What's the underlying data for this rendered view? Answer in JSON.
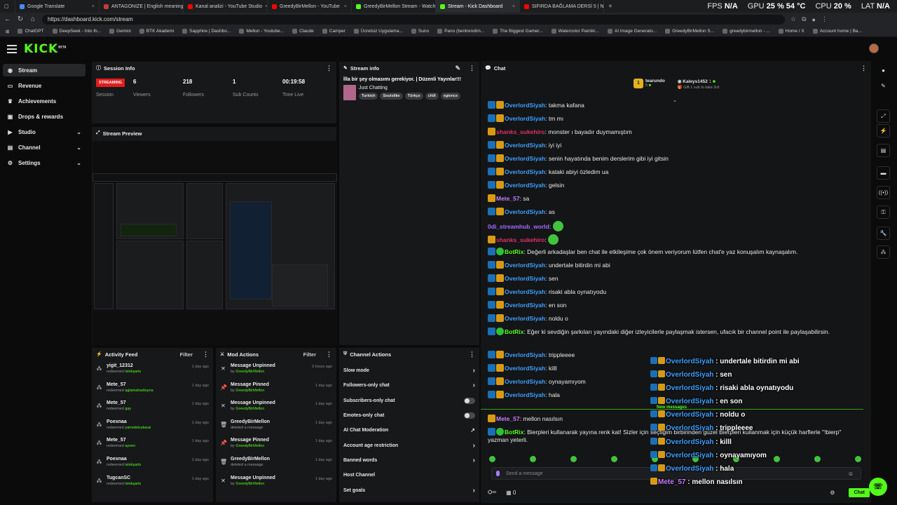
{
  "tabs": [
    {
      "label": "Google Translate",
      "color": "#4a8af4",
      "active": false
    },
    {
      "label": "ANTAGONIZE | English meaning - ...",
      "color": "#c53b3b",
      "active": false
    },
    {
      "label": "Kanal analizi - YouTube Studio",
      "color": "#ff0000",
      "active": false
    },
    {
      "label": "GreedyBirMellon - YouTube",
      "color": "#ff0000",
      "active": false
    },
    {
      "label": "GreedyBirMellon Stream - Watch Li...",
      "color": "#53fc18",
      "active": false
    },
    {
      "label": "Stream - Kick Dashboard",
      "color": "#53fc18",
      "active": true
    },
    {
      "label": "SIFIRDA BAĞLAMA DERSİ 5 | Nota...",
      "color": "#ff0000",
      "active": false
    }
  ],
  "sys": {
    "fps_label": "FPS",
    "fps": "N/A",
    "gpu_label": "GPU",
    "gpu": "25 %  54 °C",
    "cpu_label": "CPU",
    "cpu": "20 %",
    "lat_label": "LAT",
    "lat": "N/A"
  },
  "url": "https://dashboard.kick.com/stream",
  "bookmarks": [
    "ChatGPT",
    "DeepSeek - Into th...",
    "Gemini",
    "BTK Akademi",
    "Sapphire | Dashbo...",
    "Mellon - Youtube...",
    "Claude",
    "Camper",
    "Ücretsiz Uygulama...",
    "Suno",
    "Pano (bentrendim...",
    "The Biggest Gamer...",
    "Watercolor Paintin...",
    "AI Image Generato...",
    "GreedyBirMellon S...",
    "greedybirmellon - ...",
    "Home / X",
    "Account home | Ba..."
  ],
  "logo": "KICK",
  "logo_sup": "BETA",
  "sidebar": [
    {
      "label": "Stream",
      "icon": "broadcast-icon",
      "active": true,
      "chev": false
    },
    {
      "label": "Revenue",
      "icon": "wallet-icon",
      "active": false,
      "chev": false
    },
    {
      "label": "Achievements",
      "icon": "trophy-icon",
      "active": false,
      "chev": false
    },
    {
      "label": "Drops & rewards",
      "icon": "gift-icon",
      "active": false,
      "chev": false
    },
    {
      "label": "Studio",
      "icon": "studio-icon",
      "active": false,
      "chev": true
    },
    {
      "label": "Channel",
      "icon": "channel-icon",
      "active": false,
      "chev": true
    },
    {
      "label": "Settings",
      "icon": "gear-icon",
      "active": false,
      "chev": true
    }
  ],
  "session": {
    "title": "Session Info",
    "badge": "STREAMING",
    "session_label": "Session",
    "stats": [
      {
        "value": "6",
        "label": "Viewers"
      },
      {
        "value": "218",
        "label": "Followers"
      },
      {
        "value": "1",
        "label": "Sub Counts"
      },
      {
        "value": "00:19:58",
        "label": "Time Live"
      }
    ]
  },
  "preview": {
    "title": "Stream Preview"
  },
  "stream_info": {
    "header": "Stream info",
    "title": "İlla bir şey olmasımı gerekiyor. | Düzenli Yayınlar!!!",
    "category": "Just Chatting",
    "tags": [
      "Turkish",
      "Soulslike",
      "Türkçe",
      "chill",
      "eglence"
    ]
  },
  "activity": {
    "title": "Activity Feed",
    "filter": "Filter",
    "items": [
      {
        "name": "yigit_12312",
        "text": "redeemed",
        "reward": "istekşarkı",
        "time": "1 day ago"
      },
      {
        "name": "Mete_57",
        "text": "redeemed",
        "reward": "aglamahadioyna",
        "time": "1 day ago"
      },
      {
        "name": "Mete_57",
        "text": "redeemed",
        "reward": "gay",
        "time": "1 day ago"
      },
      {
        "name": "Poexnaa",
        "text": "redeemed",
        "reward": "yametekudasai",
        "time": "1 day ago"
      },
      {
        "name": "Mete_57",
        "text": "redeemed",
        "reward": "aynen",
        "time": "1 day ago"
      },
      {
        "name": "Poexnaa",
        "text": "redeemed",
        "reward": "istekşarkı",
        "time": "1 day ago"
      },
      {
        "name": "TugcanSC",
        "text": "redeemed",
        "reward": "istekşarkı",
        "time": "1 day ago"
      }
    ]
  },
  "mod": {
    "title": "Mod Actions",
    "filter": "Filter",
    "items": [
      {
        "action": "Message Unpinned",
        "sub": "by",
        "who": "GreedyBirMellon",
        "time": "3 hours ago",
        "icon": "unpin-icon"
      },
      {
        "action": "Message Pinned",
        "sub": "by",
        "who": "GreedyBirMellon",
        "time": "1 day ago",
        "icon": "pin-icon"
      },
      {
        "action": "Message Unpinned",
        "sub": "by",
        "who": "GreedyBirMellon",
        "time": "1 day ago",
        "icon": "unpin-icon"
      },
      {
        "action": "GreedyBirMellon",
        "sub": "deleted a message",
        "who": "",
        "time": "1 day ago",
        "icon": "trash-icon"
      },
      {
        "action": "Message Pinned",
        "sub": "by",
        "who": "GreedyBirMellon",
        "time": "1 day ago",
        "icon": "pin-icon"
      },
      {
        "action": "GreedyBirMellon",
        "sub": "deleted a message",
        "who": "",
        "time": "1 day ago",
        "icon": "trash-icon"
      },
      {
        "action": "Message Unpinned",
        "sub": "by",
        "who": "GreedyBirMellon",
        "time": "1 day ago",
        "icon": "unpin-icon"
      }
    ]
  },
  "channel_actions": {
    "title": "Channel Actions",
    "items": [
      {
        "label": "Slow mode",
        "ctrl": "arrow"
      },
      {
        "label": "Followers-only chat",
        "ctrl": "arrow"
      },
      {
        "label": "Subscribers-only chat",
        "ctrl": "toggle"
      },
      {
        "label": "Emotes-only chat",
        "ctrl": "toggle"
      },
      {
        "label": "AI Chat Moderation",
        "ctrl": "ext"
      },
      {
        "label": "Account age restriction",
        "ctrl": "arrow"
      },
      {
        "label": "Banned words",
        "ctrl": "arrow"
      },
      {
        "label": "Host Channel",
        "ctrl": "none"
      },
      {
        "label": "Set goals",
        "ctrl": "arrow"
      }
    ]
  },
  "chat": {
    "title": "Chat",
    "top1": {
      "user": "tearundo",
      "count": "5",
      "rank": "1"
    },
    "top2": {
      "user": "Kaleys1452",
      "count": "1",
      "gift": "Gift 1 sub to take 3rd"
    },
    "messages": [
      {
        "user": "OverlordSiyah",
        "color": "#3ea0ff",
        "badges": [
          "mod",
          "vip"
        ],
        "text": "takma kafana"
      },
      {
        "user": "OverlordSiyah",
        "color": "#3ea0ff",
        "badges": [
          "mod",
          "vip"
        ],
        "text": "tm mı"
      },
      {
        "user": "shanks_sukehiro",
        "color": "#e0306a",
        "badges": [
          "vip"
        ],
        "text": "monster ı bayadır duymamıştım"
      },
      {
        "user": "OverlordSiyah",
        "color": "#3ea0ff",
        "badges": [
          "mod",
          "vip"
        ],
        "text": "iyi iyi"
      },
      {
        "user": "OverlordSiyah",
        "color": "#3ea0ff",
        "badges": [
          "mod",
          "vip"
        ],
        "text": "senin hayatında benim derslerim gibi iyi gitsin"
      },
      {
        "user": "OverlordSiyah",
        "color": "#3ea0ff",
        "badges": [
          "mod",
          "vip"
        ],
        "text": "kataki abiyi özledim ua"
      },
      {
        "user": "OverlordSiyah",
        "color": "#3ea0ff",
        "badges": [
          "mod",
          "vip"
        ],
        "text": "gelsin"
      },
      {
        "user": "Mete_57",
        "color": "#c77dff",
        "badges": [
          "vip"
        ],
        "text": "sa"
      },
      {
        "user": "OverlordSiyah",
        "color": "#3ea0ff",
        "badges": [
          "mod",
          "vip"
        ],
        "text": "as"
      },
      {
        "user": "0di_streamhub_world",
        "color": "#a46bff",
        "badges": [],
        "text": "",
        "emote": true
      },
      {
        "user": "shanks_sukehiro",
        "color": "#e0306a",
        "badges": [
          "vip"
        ],
        "text": "",
        "emote": true
      },
      {
        "user": "BotRix",
        "color": "#53fc18",
        "badges": [
          "mod",
          "bot"
        ],
        "text": "Değerli arkadaşlar ben chat ile etkileşime çok önem veriyorum lütfen chat'e yaz konuşalım kaynaşalım."
      },
      {
        "user": "OverlordSiyah",
        "color": "#3ea0ff",
        "badges": [
          "mod",
          "vip"
        ],
        "text": "undertale bitirdin mi abi"
      },
      {
        "user": "OverlordSiyah",
        "color": "#3ea0ff",
        "badges": [
          "mod",
          "vip"
        ],
        "text": "sen"
      },
      {
        "user": "OverlordSiyah",
        "color": "#3ea0ff",
        "badges": [
          "mod",
          "vip"
        ],
        "text": "risaki abla oynatıyodu"
      },
      {
        "user": "OverlordSiyah",
        "color": "#3ea0ff",
        "badges": [
          "mod",
          "vip"
        ],
        "text": "en son"
      },
      {
        "user": "OverlordSiyah",
        "color": "#3ea0ff",
        "badges": [
          "mod",
          "vip"
        ],
        "text": "noldu o"
      },
      {
        "user": "BotRix",
        "color": "#53fc18",
        "badges": [
          "mod",
          "bot"
        ],
        "text": "Eğer ki sevdiğin şarkıları yayındaki diğer izleyicilerle paylaşmak istersen, ufacık bir channel point ile paylaşabilirsin.",
        "tall": true
      },
      {
        "user": "OverlordSiyah",
        "color": "#3ea0ff",
        "badges": [
          "mod",
          "vip"
        ],
        "text": "trippleeee"
      },
      {
        "user": "OverlordSiyah",
        "color": "#3ea0ff",
        "badges": [
          "mod",
          "vip"
        ],
        "text": "killl"
      },
      {
        "user": "OverlordSiyah",
        "color": "#3ea0ff",
        "badges": [
          "mod",
          "vip"
        ],
        "text": "oynayamıyom"
      },
      {
        "user": "OverlordSiyah",
        "color": "#3ea0ff",
        "badges": [
          "mod",
          "vip"
        ],
        "text": "hala"
      },
      {
        "user": "Mete_57",
        "color": "#c77dff",
        "badges": [
          "vip"
        ],
        "text": "mellon nasılsın",
        "gap": true
      },
      {
        "user": "BotRix",
        "color": "#53fc18",
        "badges": [
          "mod",
          "bot"
        ],
        "text": "Bierpleri kullanarak yayına renk kat! Sizler için seçtiğim birbirinden güzel Bierpleri kullanmak için küçük harflerle \"!bierp\" yazman yeterli.",
        "tall": true
      }
    ],
    "new_messages": "New messages",
    "placeholder": "Send a message",
    "footer_count": "0",
    "send": "Chat"
  },
  "overlay": [
    {
      "user": "OverlordSiyah",
      "color": "#3ea0ff",
      "badges": [
        "mod",
        "vip"
      ],
      "text": "undertale bitirdin mi abi"
    },
    {
      "user": "OverlordSiyah",
      "color": "#3ea0ff",
      "badges": [
        "mod",
        "vip"
      ],
      "text": "sen"
    },
    {
      "user": "OverlordSiyah",
      "color": "#3ea0ff",
      "badges": [
        "mod",
        "vip"
      ],
      "text": "risaki abla oynatıyodu"
    },
    {
      "user": "OverlordSiyah",
      "color": "#3ea0ff",
      "badges": [
        "mod",
        "vip"
      ],
      "text": "en son"
    },
    {
      "user": "OverlordSiyah",
      "color": "#3ea0ff",
      "badges": [
        "mod",
        "vip"
      ],
      "text": "noldu o"
    },
    {
      "user": "OverlordSiyah",
      "color": "#3ea0ff",
      "badges": [
        "mod",
        "vip"
      ],
      "text": "trippleeee"
    },
    {
      "user": "OverlordSiyah",
      "color": "#3ea0ff",
      "badges": [
        "mod",
        "vip"
      ],
      "text": "killl"
    },
    {
      "user": "OverlordSiyah",
      "color": "#3ea0ff",
      "badges": [
        "mod",
        "vip"
      ],
      "text": "oynayamıyom"
    },
    {
      "user": "OverlordSiyah",
      "color": "#3ea0ff",
      "badges": [
        "mod",
        "vip"
      ],
      "text": "hala"
    },
    {
      "user": "Mete_57",
      "color": "#c77dff",
      "badges": [
        "vip"
      ],
      "text": "mellon nasılsın"
    }
  ],
  "rail": [
    "info-icon",
    "edit-icon",
    "expand-icon",
    "bolt-icon",
    "notes-icon",
    "chat-icon",
    "broadcast-icon",
    "settings-panel-icon",
    "wrench-icon",
    "users-icon"
  ],
  "accent": "#53fc18"
}
